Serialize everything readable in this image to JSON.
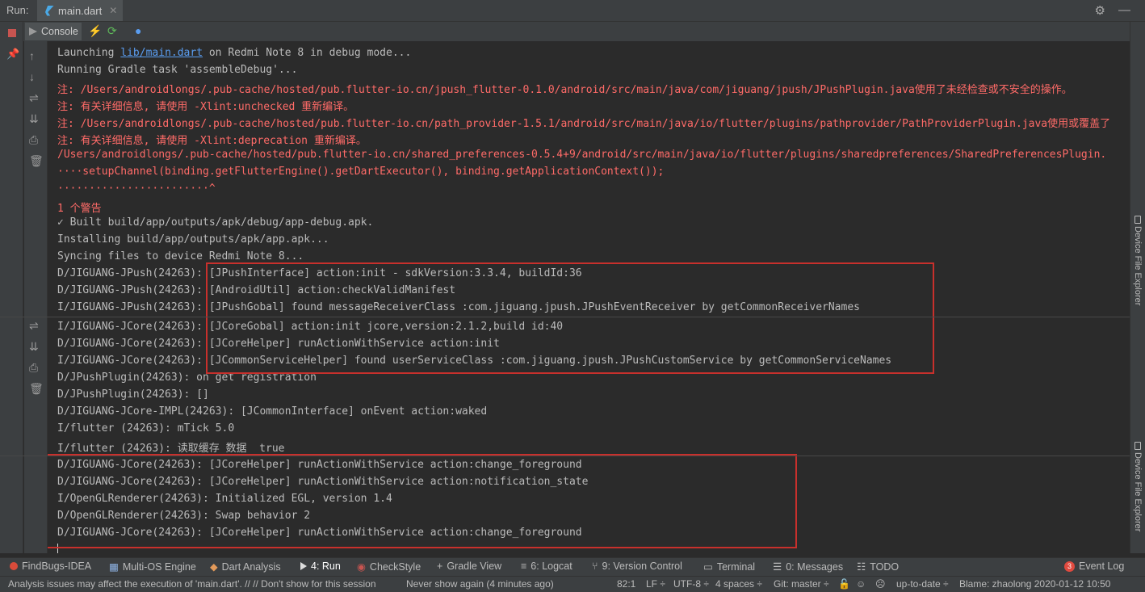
{
  "window": {
    "run_label": "Run:",
    "tab_label": "main.dart",
    "console_tab": "Console",
    "side_panel_label": "Device File Explorer"
  },
  "console": {
    "lines": [
      {
        "text": "Launching ",
        "link": "lib/main.dart",
        "after": " on Redmi Note 8 in debug mode...",
        "kind": "normal"
      },
      {
        "text": "Running Gradle task 'assembleDebug'...",
        "kind": "normal"
      },
      {
        "text": "注: /Users/androidlongs/.pub-cache/hosted/pub.flutter-io.cn/jpush_flutter-0.1.0/android/src/main/java/com/jiguang/jpush/JPushPlugin.java使用了未经检查或不安全的操作。",
        "kind": "err"
      },
      {
        "text": "注: 有关详细信息, 请使用 -Xlint:unchecked 重新编译。",
        "kind": "err"
      },
      {
        "text": "注: /Users/androidlongs/.pub-cache/hosted/pub.flutter-io.cn/path_provider-1.5.1/android/src/main/java/io/flutter/plugins/pathprovider/PathProviderPlugin.java使用或覆盖了",
        "kind": "err"
      },
      {
        "text": "注: 有关详细信息, 请使用 -Xlint:deprecation 重新编译。",
        "kind": "err"
      },
      {
        "text": "/Users/androidlongs/.pub-cache/hosted/pub.flutter-io.cn/shared_preferences-0.5.4+9/android/src/main/java/io/flutter/plugins/sharedpreferences/SharedPreferencesPlugin.",
        "kind": "err"
      },
      {
        "text": "····setupChannel(binding.getFlutterEngine().getDartExecutor(), binding.getApplicationContext());",
        "kind": "err"
      },
      {
        "text": "························^",
        "kind": "err"
      },
      {
        "text": "1 个警告",
        "kind": "err"
      },
      {
        "text": "✓ Built build/app/outputs/apk/debug/app-debug.apk.",
        "kind": "normal"
      },
      {
        "text": "Installing build/app/outputs/apk/app.apk...",
        "kind": "normal"
      },
      {
        "text": "Syncing files to device Redmi Note 8...",
        "kind": "normal"
      },
      {
        "text": "D/JIGUANG-JPush(24263): [JPushInterface] action:init - sdkVersion:3.3.4, buildId:36",
        "kind": "normal"
      },
      {
        "text": "D/JIGUANG-JPush(24263): [AndroidUtil] action:checkValidManifest",
        "kind": "normal"
      },
      {
        "text": "I/JIGUANG-JPush(24263): [JPushGobal] found messageReceiverClass :com.jiguang.jpush.JPushEventReceiver by getCommonReceiverNames",
        "kind": "normal"
      },
      {
        "text": "I/JIGUANG-JCore(24263): [JCoreGobal] action:init jcore,version:2.1.2,build id:40",
        "kind": "normal"
      },
      {
        "text": "D/JIGUANG-JCore(24263): [JCoreHelper] runActionWithService action:init",
        "kind": "normal"
      },
      {
        "text": "I/JIGUANG-JCore(24263): [JCommonServiceHelper] found userServiceClass :com.jiguang.jpush.JPushCustomService by getCommonServiceNames",
        "kind": "normal"
      },
      {
        "text": "D/JPushPlugin(24263): on get registration",
        "kind": "normal"
      },
      {
        "text": "D/JPushPlugin(24263): []",
        "kind": "normal"
      },
      {
        "text": "D/JIGUANG-JCore-IMPL(24263): [JCommonInterface] onEvent action:waked",
        "kind": "normal"
      },
      {
        "text": "I/flutter (24263): mTick 5.0",
        "kind": "normal"
      },
      {
        "text": "I/flutter (24263): 读取缓存 数据  true",
        "kind": "normal"
      },
      {
        "text": "D/JIGUANG-JCore(24263): [JCoreHelper] runActionWithService action:change_foreground",
        "kind": "normal"
      },
      {
        "text": "D/JIGUANG-JCore(24263): [JCoreHelper] runActionWithService action:notification_state",
        "kind": "normal"
      },
      {
        "text": "I/OpenGLRenderer(24263): Initialized EGL, version 1.4",
        "kind": "normal"
      },
      {
        "text": "D/OpenGLRenderer(24263): Swap behavior 2",
        "kind": "normal"
      },
      {
        "text": "D/JIGUANG-JCore(24263): [JCoreHelper] runActionWithService action:change_foreground",
        "kind": "normal"
      }
    ]
  },
  "tool_windows": [
    {
      "label": "FindBugs-IDEA",
      "icon": "bug-icon"
    },
    {
      "label": "Multi-OS Engine",
      "icon": "multi-os-icon"
    },
    {
      "label": "Dart Analysis",
      "icon": "dart-icon"
    },
    {
      "label": "4: Run",
      "icon": "run-icon",
      "active": true
    },
    {
      "label": "CheckStyle",
      "icon": "checkstyle-icon"
    },
    {
      "label": "Gradle View",
      "icon": "plus-icon"
    },
    {
      "label": "6: Logcat",
      "icon": "logcat-icon"
    },
    {
      "label": "9: Version Control",
      "icon": "vcs-icon"
    },
    {
      "label": "Terminal",
      "icon": "terminal-icon"
    },
    {
      "label": "0: Messages",
      "icon": "messages-icon"
    },
    {
      "label": "TODO",
      "icon": "todo-icon"
    },
    {
      "label": "Event Log",
      "icon": "event-log-icon",
      "badge": "3"
    }
  ],
  "status": {
    "message": "Analysis issues may affect the execution of 'main.dart'. // // Don't show for this session",
    "never_show": "Never show again (4 minutes ago)",
    "position": "82:1",
    "line_sep": "LF ÷",
    "encoding": "UTF-8 ÷",
    "indent": "4 spaces ÷",
    "git": "Git: master ÷",
    "uptodate": "up-to-date ÷",
    "blame": "Blame: zhaolong 2020-01-12 10:50"
  },
  "colors": {
    "background": "#2b2b2b",
    "panel": "#3c3f41",
    "error_text": "#ff6b68",
    "link": "#5a9df0",
    "highlight_box": "#c8302c"
  }
}
